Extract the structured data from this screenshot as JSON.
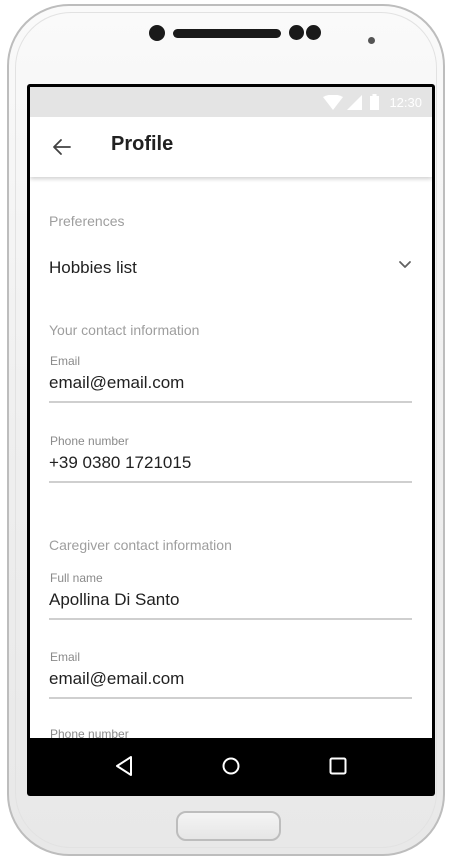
{
  "status_bar": {
    "time": "12:30",
    "icons": [
      "wifi-icon",
      "signal-icon",
      "battery-icon"
    ]
  },
  "app_bar": {
    "back_icon": "arrow-left-icon",
    "title": "Profile"
  },
  "preferences": {
    "section_label": "Preferences",
    "hobbies_dropdown": {
      "value": "Hobbies list",
      "icon": "chevron-down-icon"
    }
  },
  "contact_info": {
    "section_label": "Your contact information",
    "email": {
      "label": "Email",
      "value": "email@email.com"
    },
    "phone": {
      "label": "Phone number",
      "value": "+39 0380 1721015"
    }
  },
  "caregiver_info": {
    "section_label": "Caregiver contact information",
    "full_name": {
      "label": "Full name",
      "value": "Apollina Di Santo"
    },
    "email": {
      "label": "Email",
      "value": "email@email.com"
    },
    "phone": {
      "label": "Phone number"
    }
  },
  "nav_bar": {
    "icons": [
      "back-triangle-icon",
      "home-circle-icon",
      "recents-square-icon"
    ]
  },
  "colors": {
    "section_label": "#9e9e9e",
    "text_primary": "#212121",
    "underline": "#cfcfcf",
    "status_bar": "#e4e4e4",
    "nav_bar": "#000000"
  }
}
